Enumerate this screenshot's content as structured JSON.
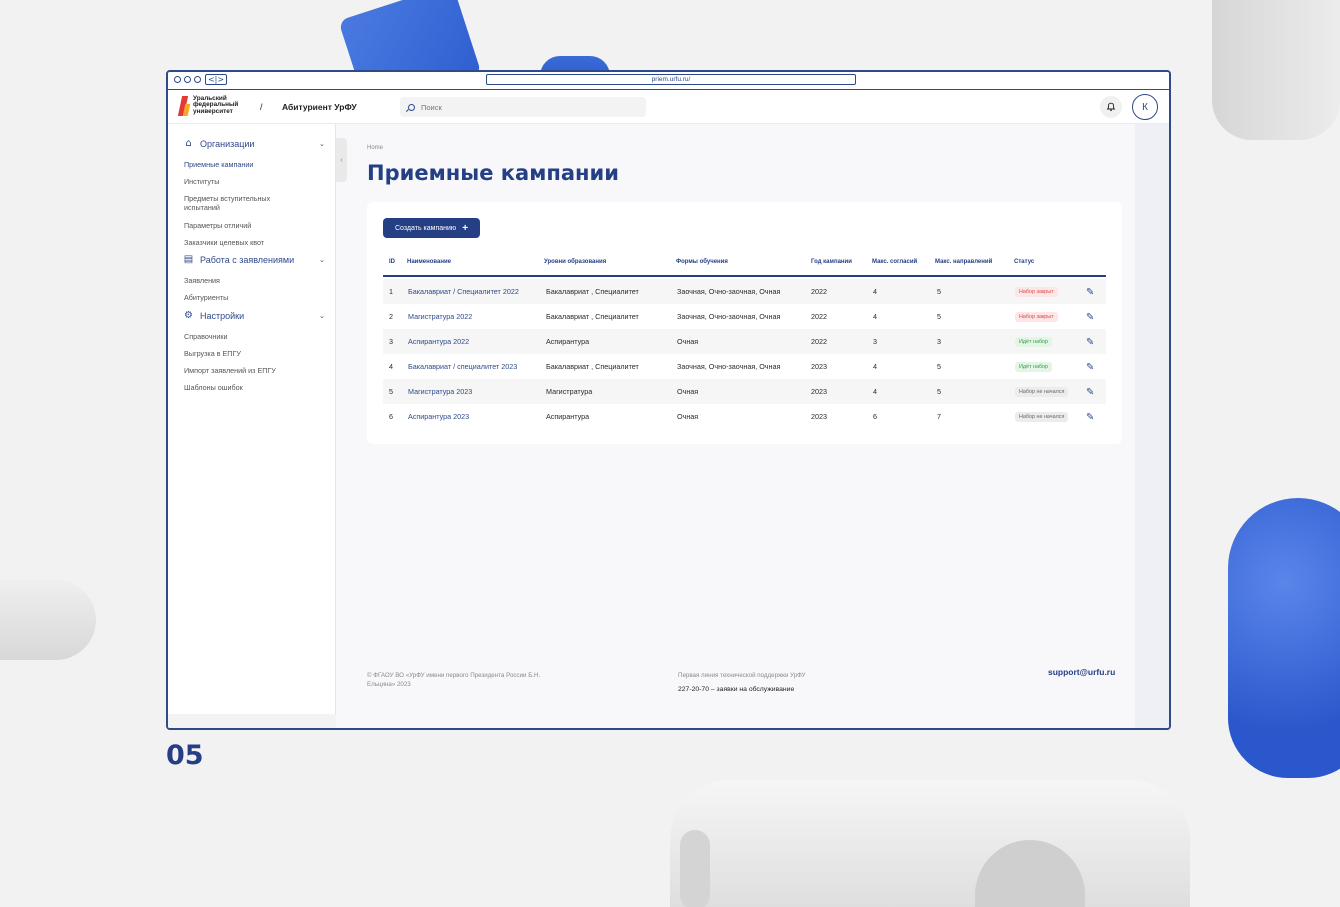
{
  "browser": {
    "url": "priem.urfu.ru/",
    "nav_arrows": "<|>"
  },
  "header": {
    "logo_text": "Уральский федеральный университет",
    "separator": "/",
    "app_name": "Абитуриент УрФУ",
    "search_placeholder": "Поиск",
    "avatar_initial": "К"
  },
  "sidebar": {
    "groups": [
      {
        "label": "Организации",
        "icon": "building-icon",
        "items": [
          "Приемные кампании",
          "Институты",
          "Предметы вступительных испытаний",
          "Параметры отличий",
          "Заказчики целевых квот"
        ]
      },
      {
        "label": "Работа с заявлениями",
        "icon": "document-icon",
        "items": [
          "Заявления",
          "Абитуриенты"
        ]
      },
      {
        "label": "Настройки",
        "icon": "gear-icon",
        "items": [
          "Справочники",
          "Выгрузка в ЕПГУ",
          "Импорт заявлений из ЕПГУ",
          "Шаблоны ошибок"
        ]
      }
    ]
  },
  "main": {
    "breadcrumb": "Home",
    "title": "Приемные кампании",
    "create_button": "Создать кампанию",
    "table": {
      "columns": [
        "ID",
        "Наименование",
        "Уровни образования",
        "Формы обучения",
        "Год кампании",
        "Макс. согласий",
        "Макс. направлений",
        "Статус"
      ],
      "rows": [
        {
          "id": "1",
          "name": "Бакалавриат / Специалитет 2022",
          "levels": "Бакалавриат , Специалитет",
          "forms": "Заочная, Очно-заочная, Очная",
          "year": "2022",
          "max_consents": "4",
          "max_directions": "5",
          "status": "Набор закрыт",
          "status_type": "closed"
        },
        {
          "id": "2",
          "name": "Магистратура 2022",
          "levels": "Бакалавриат , Специалитет",
          "forms": "Заочная, Очно-заочная, Очная",
          "year": "2022",
          "max_consents": "4",
          "max_directions": "5",
          "status": "Набор закрыт",
          "status_type": "closed"
        },
        {
          "id": "3",
          "name": "Аспирантура 2022",
          "levels": "Аспирантура",
          "forms": "Очная",
          "year": "2022",
          "max_consents": "3",
          "max_directions": "3",
          "status": "Идёт набор",
          "status_type": "open"
        },
        {
          "id": "4",
          "name": "Бакалавриат / специалитет 2023",
          "levels": "Бакалавриат , Специалитет",
          "forms": "Заочная, Очно-заочная, Очная",
          "year": "2023",
          "max_consents": "4",
          "max_directions": "5",
          "status": "Идёт набор",
          "status_type": "open"
        },
        {
          "id": "5",
          "name": "Магистратура 2023",
          "levels": "Магистратура",
          "forms": "Очная",
          "year": "2023",
          "max_consents": "4",
          "max_directions": "5",
          "status": "Набор не начался",
          "status_type": "notstarted"
        },
        {
          "id": "6",
          "name": "Аспирантура 2023",
          "levels": "Аспирантура",
          "forms": "Очная",
          "year": "2023",
          "max_consents": "6",
          "max_directions": "7",
          "status": "Набор не начался",
          "status_type": "notstarted"
        }
      ]
    }
  },
  "footer": {
    "copyright": "© ФГАОУ ВО «УрФУ имени первого Президента России Б.Н. Ельцина» 2023",
    "support_line": "Первая линия технической поддержки УрФУ",
    "phone": "227-20-70 – заявки на обслуживание",
    "email": "support@urfu.ru"
  },
  "page_number": "05",
  "colors": {
    "brand": "#253f85",
    "closed": "#d24b4b",
    "open": "#3b9b4a",
    "logo_red": "#e53935",
    "logo_yellow": "#f9a825"
  }
}
